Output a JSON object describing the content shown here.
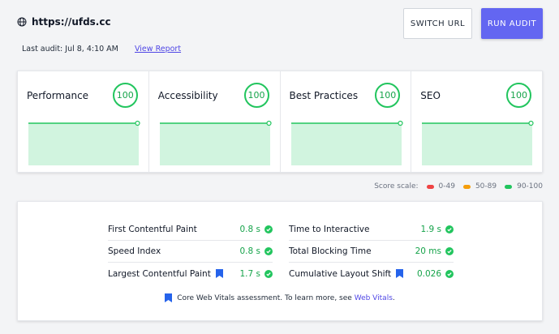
{
  "header": {
    "url": "https://ufds.cc",
    "last_audit": "Last audit: Jul 8, 4:10 AM",
    "view_report": "View Report",
    "switch_url": "SWITCH URL",
    "run_audit": "RUN AUDIT"
  },
  "scores": [
    {
      "name": "Performance",
      "value": "100"
    },
    {
      "name": "Accessibility",
      "value": "100"
    },
    {
      "name": "Best Practices",
      "value": "100"
    },
    {
      "name": "SEO",
      "value": "100"
    }
  ],
  "score_scale": {
    "label": "Score scale:",
    "ranges": [
      {
        "label": "0-49",
        "color": "#ef4444"
      },
      {
        "label": "50-89",
        "color": "#f59e0b"
      },
      {
        "label": "90-100",
        "color": "#22c55e"
      }
    ]
  },
  "metrics": {
    "left": [
      {
        "label": "First Contentful Paint",
        "value": "0.8 s",
        "cwv": false
      },
      {
        "label": "Speed Index",
        "value": "0.8 s",
        "cwv": false
      },
      {
        "label": "Largest Contentful Paint",
        "value": "1.7 s",
        "cwv": true
      }
    ],
    "right": [
      {
        "label": "Time to Interactive",
        "value": "1.9 s",
        "cwv": false
      },
      {
        "label": "Total Blocking Time",
        "value": "20 ms",
        "cwv": false
      },
      {
        "label": "Cumulative Layout Shift",
        "value": "0.026",
        "cwv": true
      }
    ]
  },
  "cwv_note": {
    "text": "Core Web Vitals assessment. To learn more, see",
    "link": "Web Vitals",
    "suffix": "."
  },
  "colors": {
    "accent": "#6366f1",
    "good": "#22c55e",
    "chart_fill": "#d1f4df"
  },
  "icons": {
    "url": "globe-icon",
    "cwv": "bookmark-icon",
    "status": "check-circle-icon"
  }
}
